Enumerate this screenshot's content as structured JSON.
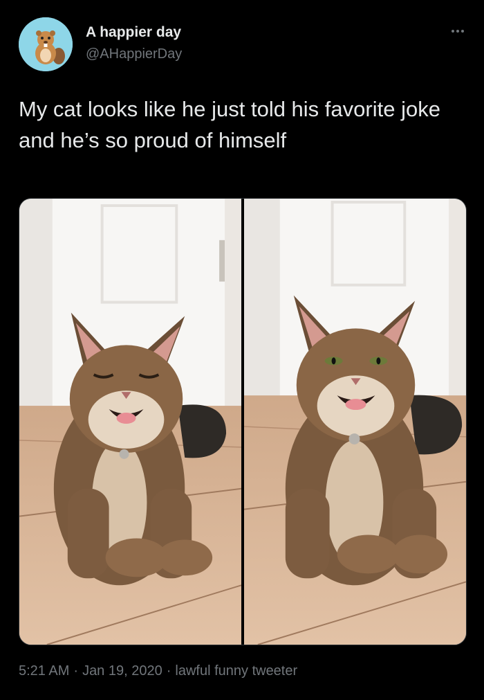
{
  "author": {
    "display_name": "A happier day",
    "handle": "@AHappierDay",
    "avatar_icon": "beaver-avatar-icon"
  },
  "tweet": {
    "text": "My cat looks like he just told his favorite joke and he’s so proud of himself"
  },
  "media": {
    "photos": [
      {
        "description_icon": "smiling-cat-eyes-closed-photo"
      },
      {
        "description_icon": "smiling-cat-eyes-open-photo"
      }
    ]
  },
  "meta": {
    "time": "5:21 AM",
    "date": "Jan 19, 2020",
    "source": "lawful funny tweeter",
    "separator": "·"
  },
  "colors": {
    "background": "#000000",
    "primary_text": "#e7e9ea",
    "secondary_text": "#71767b",
    "avatar_bg": "#8ed6e8"
  }
}
